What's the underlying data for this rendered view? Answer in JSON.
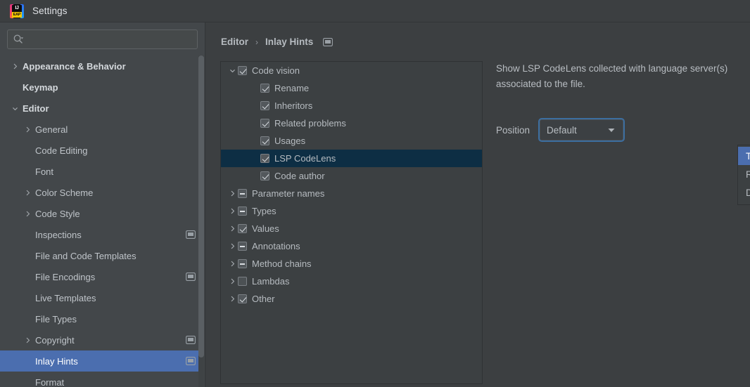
{
  "window": {
    "title": "Settings",
    "logo_icon": "intellij-idea-eap-logo",
    "logo_text_top": "IJ",
    "logo_text_bottom": "EAP"
  },
  "search": {
    "value": "",
    "placeholder": "",
    "icon": "search-icon",
    "dropdown_icon": "triangle-down-icon"
  },
  "sidebar": {
    "items": [
      {
        "label": "Appearance & Behavior",
        "depth": 0,
        "arrow": "chevron-right",
        "bold": true,
        "selected": false,
        "trailing_icon": ""
      },
      {
        "label": "Keymap",
        "depth": 0,
        "arrow": "",
        "bold": true,
        "selected": false,
        "trailing_icon": ""
      },
      {
        "label": "Editor",
        "depth": 0,
        "arrow": "chevron-down",
        "bold": true,
        "selected": false,
        "trailing_icon": ""
      },
      {
        "label": "General",
        "depth": 1,
        "arrow": "chevron-right",
        "bold": false,
        "selected": false,
        "trailing_icon": ""
      },
      {
        "label": "Code Editing",
        "depth": 1,
        "arrow": "",
        "bold": false,
        "selected": false,
        "trailing_icon": ""
      },
      {
        "label": "Font",
        "depth": 1,
        "arrow": "",
        "bold": false,
        "selected": false,
        "trailing_icon": ""
      },
      {
        "label": "Color Scheme",
        "depth": 1,
        "arrow": "chevron-right",
        "bold": false,
        "selected": false,
        "trailing_icon": ""
      },
      {
        "label": "Code Style",
        "depth": 1,
        "arrow": "chevron-right",
        "bold": false,
        "selected": false,
        "trailing_icon": ""
      },
      {
        "label": "Inspections",
        "depth": 1,
        "arrow": "",
        "bold": false,
        "selected": false,
        "trailing_icon": "monitor-icon"
      },
      {
        "label": "File and Code Templates",
        "depth": 1,
        "arrow": "",
        "bold": false,
        "selected": false,
        "trailing_icon": ""
      },
      {
        "label": "File Encodings",
        "depth": 1,
        "arrow": "",
        "bold": false,
        "selected": false,
        "trailing_icon": "monitor-icon"
      },
      {
        "label": "Live Templates",
        "depth": 1,
        "arrow": "",
        "bold": false,
        "selected": false,
        "trailing_icon": ""
      },
      {
        "label": "File Types",
        "depth": 1,
        "arrow": "",
        "bold": false,
        "selected": false,
        "trailing_icon": ""
      },
      {
        "label": "Copyright",
        "depth": 1,
        "arrow": "chevron-right",
        "bold": false,
        "selected": false,
        "trailing_icon": "monitor-icon"
      },
      {
        "label": "Inlay Hints",
        "depth": 1,
        "arrow": "",
        "bold": false,
        "selected": true,
        "trailing_icon": "monitor-icon"
      },
      {
        "label": "Format",
        "depth": 1,
        "arrow": "",
        "bold": false,
        "selected": false,
        "trailing_icon": ""
      }
    ]
  },
  "breadcrumb": {
    "root": "Editor",
    "separator": "›",
    "current": "Inlay Hints",
    "icon": "monitor-icon"
  },
  "tree": {
    "rows": [
      {
        "label": "Code vision",
        "depth": 0,
        "expander": "chevron-down",
        "check": "checked",
        "selected": false
      },
      {
        "label": "Rename",
        "depth": 1,
        "expander": "",
        "check": "checked",
        "selected": false
      },
      {
        "label": "Inheritors",
        "depth": 1,
        "expander": "",
        "check": "checked",
        "selected": false
      },
      {
        "label": "Related problems",
        "depth": 1,
        "expander": "",
        "check": "checked",
        "selected": false
      },
      {
        "label": "Usages",
        "depth": 1,
        "expander": "",
        "check": "checked",
        "selected": false
      },
      {
        "label": "LSP CodeLens",
        "depth": 1,
        "expander": "",
        "check": "checked",
        "selected": true
      },
      {
        "label": "Code author",
        "depth": 1,
        "expander": "",
        "check": "checked",
        "selected": false
      },
      {
        "label": "Parameter names",
        "depth": 0,
        "expander": "chevron-right",
        "check": "indeterminate",
        "selected": false
      },
      {
        "label": "Types",
        "depth": 0,
        "expander": "chevron-right",
        "check": "indeterminate",
        "selected": false
      },
      {
        "label": "Values",
        "depth": 0,
        "expander": "chevron-right",
        "check": "checked",
        "selected": false
      },
      {
        "label": "Annotations",
        "depth": 0,
        "expander": "chevron-right",
        "check": "indeterminate",
        "selected": false
      },
      {
        "label": "Method chains",
        "depth": 0,
        "expander": "chevron-right",
        "check": "indeterminate",
        "selected": false
      },
      {
        "label": "Lambdas",
        "depth": 0,
        "expander": "chevron-right",
        "check": "unchecked",
        "selected": false
      },
      {
        "label": "Other",
        "depth": 0,
        "expander": "chevron-right",
        "check": "checked",
        "selected": false
      }
    ]
  },
  "details": {
    "description": "Show LSP CodeLens collected with language server(s) associated to the file.",
    "position_label": "Position",
    "position_value": "Default",
    "position_arrow_icon": "chevron-down-icon",
    "dropdown_open": true,
    "dropdown_options": [
      {
        "label": "Top",
        "highlighted": true
      },
      {
        "label": "Right",
        "highlighted": false
      },
      {
        "label": "Default",
        "highlighted": false
      }
    ]
  },
  "colors": {
    "window_bg": "#3c3f41",
    "sidebar_bg": "#43474a",
    "selection_blue": "#4b6eaf",
    "tree_selection_navy": "#0d2e44",
    "focus_ring": "#3c6ea0",
    "text": "#b8bdc2"
  }
}
